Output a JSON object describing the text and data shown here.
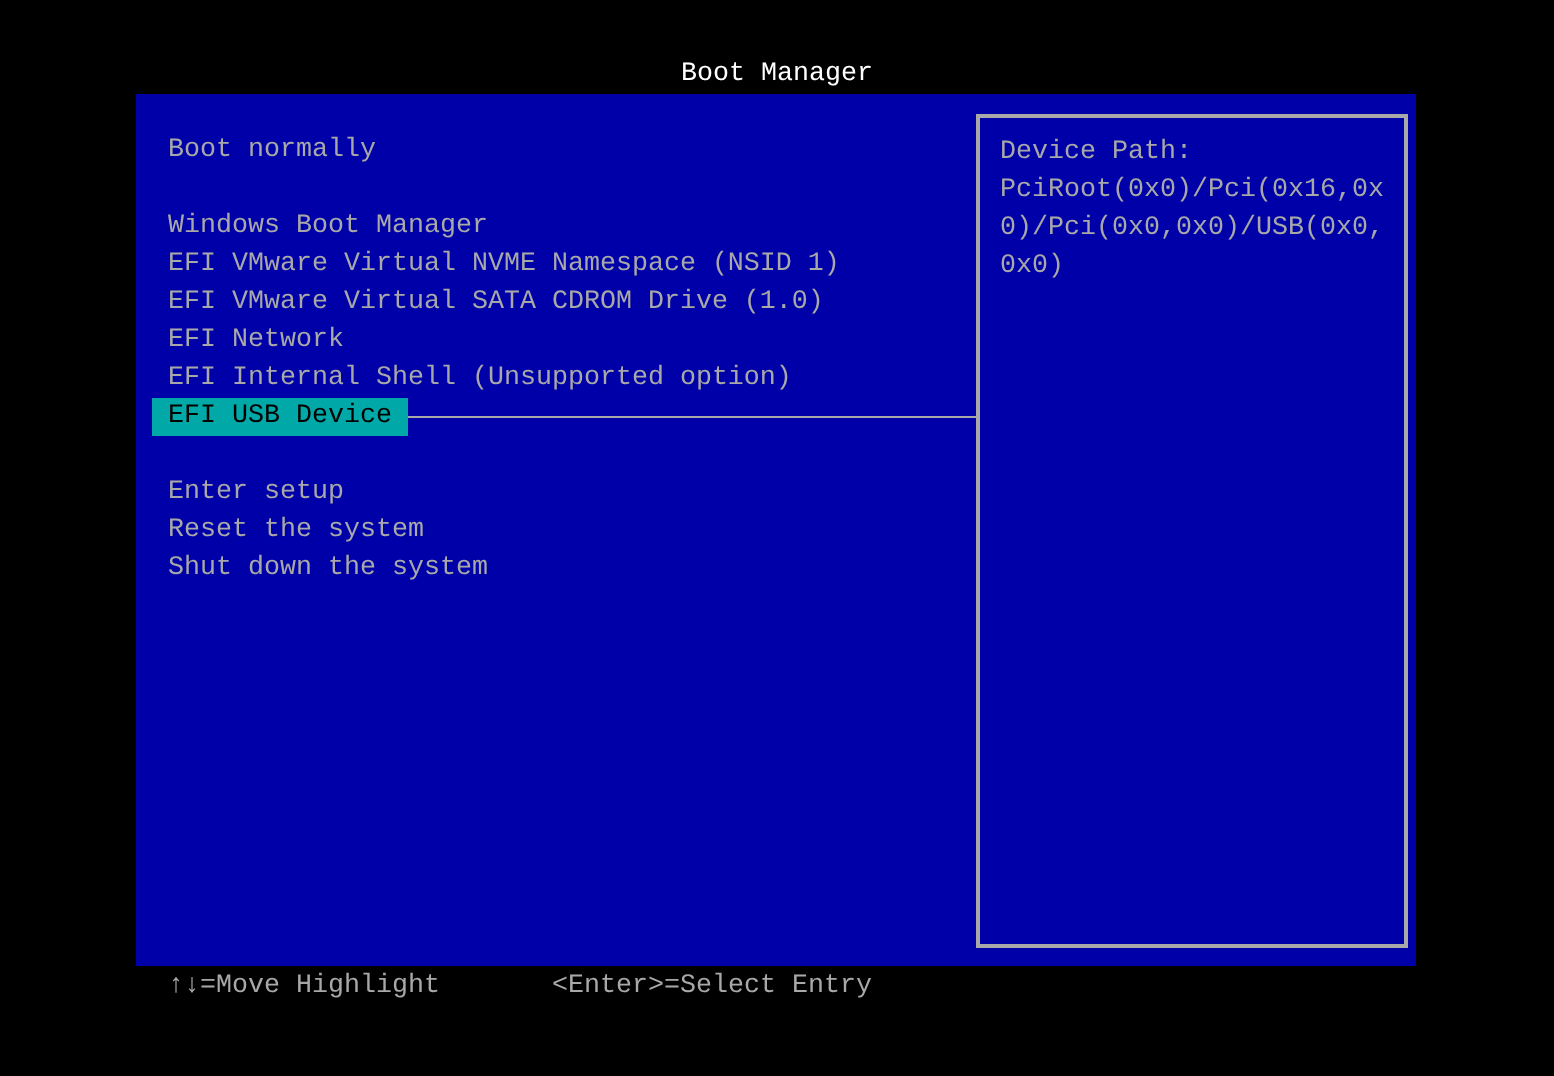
{
  "window": {
    "title": "Boot Manager"
  },
  "menu_groups": [
    {
      "items": [
        {
          "label": "Boot normally",
          "selected": false
        }
      ]
    },
    {
      "items": [
        {
          "label": "Windows Boot Manager",
          "selected": false
        },
        {
          "label": "EFI VMware Virtual NVME Namespace (NSID 1)",
          "selected": false
        },
        {
          "label": "EFI VMware Virtual SATA CDROM Drive (1.0)",
          "selected": false
        },
        {
          "label": "EFI Network",
          "selected": false
        },
        {
          "label": "EFI Internal Shell (Unsupported option)",
          "selected": false
        },
        {
          "label": "EFI USB Device",
          "selected": true
        }
      ]
    },
    {
      "items": [
        {
          "label": "Enter setup",
          "selected": false
        },
        {
          "label": "Reset the system",
          "selected": false
        },
        {
          "label": "Shut down the system",
          "selected": false
        }
      ]
    }
  ],
  "help_panel": {
    "title": "Device Path:",
    "text": "PciRoot(0x0)/Pci(0x16,0x0)/Pci(0x0,0x0)/USB(0x0,0x0)"
  },
  "status_bar": [
    "↑↓=Move Highlight",
    "<Enter>=Select Entry"
  ]
}
